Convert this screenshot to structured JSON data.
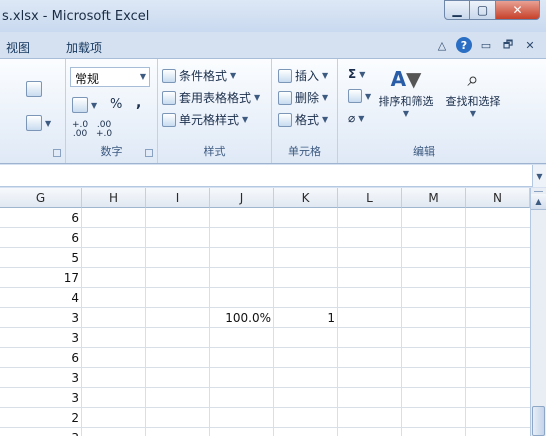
{
  "window": {
    "title": "s.xlsx - Microsoft Excel",
    "min_label": "▁",
    "max_label": "▢",
    "close_label": "✕"
  },
  "tabs": [
    "视图",
    "加载项"
  ],
  "tab_controls": {
    "collapse": "△",
    "help": "?",
    "doc_min": "▭",
    "doc_restore": "🗗",
    "doc_close": "✕"
  },
  "ribbon": {
    "number_group": {
      "format_value": "常规",
      "percent": "%",
      "comma": ",",
      "inc_dec1": "+.0",
      "inc_dec1b": ".00",
      "dec_dec1": ".00",
      "dec_dec1b": "+.0",
      "label": "数字"
    },
    "styles_group": {
      "conditional": "条件格式",
      "table": "套用表格格式",
      "cell_styles": "单元格样式",
      "label": "样式"
    },
    "cells_group": {
      "insert": "插入",
      "delete": "删除",
      "format": "格式",
      "label": "单元格"
    },
    "edit_group": {
      "sum": "Σ",
      "sort": "排序和筛选",
      "find": "查找和选择",
      "label": "编辑"
    }
  },
  "grid": {
    "columns": [
      "G",
      "H",
      "I",
      "J",
      "K",
      "L",
      "M",
      "N"
    ],
    "column_g_values": [
      "6",
      "6",
      "5",
      "17",
      "4",
      "3",
      "3",
      "6",
      "3",
      "3",
      "2",
      "3"
    ],
    "row6_j": "100.0%",
    "row6_k": "1"
  },
  "colors": {
    "accent": "#2b6fc4",
    "ribbon_border": "#9db3cf",
    "close": "#c6402a"
  }
}
